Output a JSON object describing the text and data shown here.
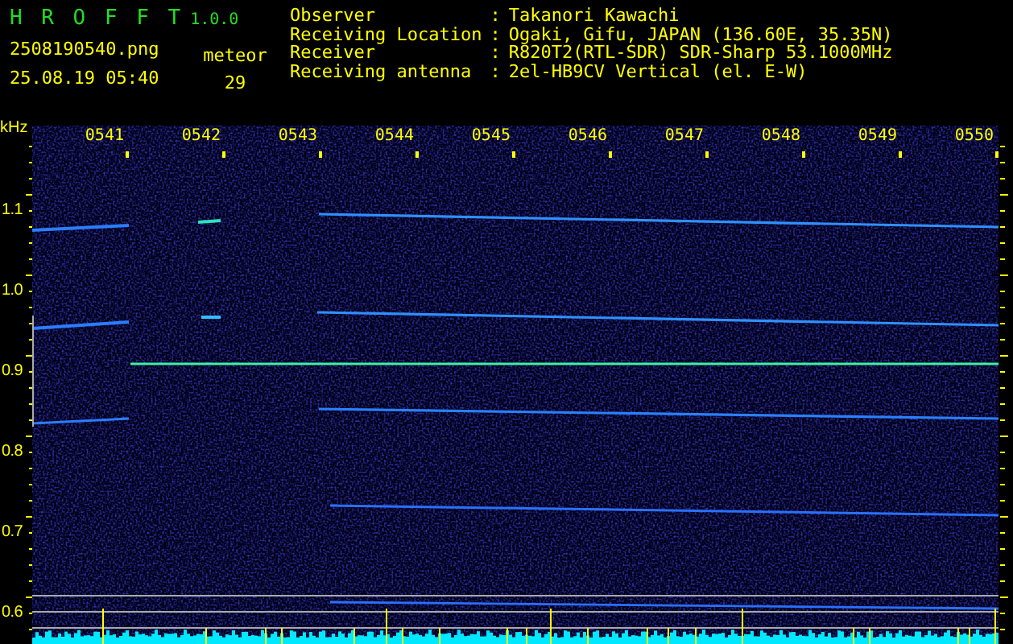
{
  "header": {
    "app_name": "H R O F F T",
    "version": "1.0.0",
    "filename": "2508190540.png",
    "datetime": "25.08.19 05:40",
    "counter_label": "meteor",
    "counter_value": "29"
  },
  "info": [
    {
      "label": "Observer",
      "separator": ":",
      "value": "Takanori Kawachi"
    },
    {
      "label": "Receiving Location",
      "separator": ":",
      "value": "Ogaki, Gifu, JAPAN (136.60E, 35.35N)"
    },
    {
      "label": "Receiver",
      "separator": ":",
      "value": "R820T2(RTL-SDR) SDR-Sharp 53.1000MHz"
    },
    {
      "label": "Receiving antenna",
      "separator": ":",
      "value": "2el-HB9CV Vertical (el. E-W)"
    }
  ],
  "spectrogram": {
    "freq_unit": "kHz",
    "time_labels": [
      "0541",
      "0542",
      "0543",
      "0544",
      "0545",
      "0546",
      "0547",
      "0548",
      "0549",
      "0550"
    ],
    "freq_labels": [
      "1.1",
      "1.0",
      "0.9",
      "0.8",
      "0.7",
      "0.6"
    ]
  }
}
